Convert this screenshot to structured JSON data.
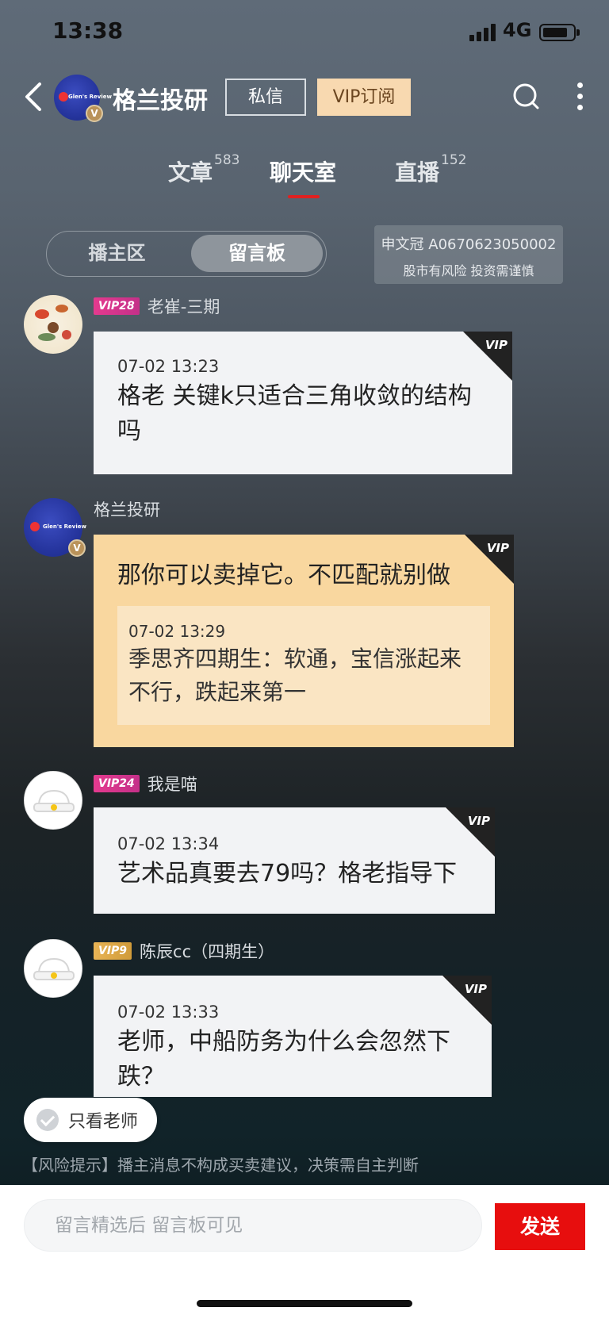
{
  "status_bar": {
    "time": "13:38",
    "network": "4G"
  },
  "header": {
    "title": "格兰投研",
    "avatar_text": "Glen's Review",
    "verified_badge": "V",
    "dm_label": "私信",
    "vip_label": "VIP订阅",
    "icons": [
      "back-icon",
      "search-icon",
      "more-icon"
    ]
  },
  "tabs": [
    {
      "label": "文章",
      "count": "583"
    },
    {
      "label": "聊天室",
      "count": ""
    },
    {
      "label": "直播",
      "count": "152"
    }
  ],
  "segmented": {
    "left": "播主区",
    "right": "留言板"
  },
  "license": {
    "line1": "申文冠 A0670623050002",
    "line2": "股市有风险 投资需谨慎"
  },
  "messages": [
    {
      "vip": "VIP28",
      "user": "老崔-三期",
      "time": "07-02 13:23",
      "text": "格老 关键k只适合三角收敛的结构吗"
    },
    {
      "user": "格兰投研",
      "text": "那你可以卖掉它。不匹配就别做",
      "quote": {
        "time": "07-02 13:29",
        "text": "季思齐四期生：软通，宝信涨起来不行，跌起来第一"
      }
    },
    {
      "vip": "VIP24",
      "user": "我是喵",
      "time": "07-02 13:34",
      "text": "艺术品真要去79吗？格老指导下"
    },
    {
      "vip": "VIP9",
      "user": "陈辰cc（四期生）",
      "time": "07-02 13:33",
      "text": "老师，中船防务为什么会忽然下跌？"
    }
  ],
  "vip_corner": "VIP",
  "only_teacher_label": "只看老师",
  "risk_notice": "【风险提示】播主消息不构成买卖建议，决策需自主判断",
  "input": {
    "placeholder": "留言精选后 留言板可见"
  },
  "send_label": "发送",
  "colors": {
    "accent_red": "#e70e0e",
    "vip_gold": "#f8d9b0",
    "teacher_bubble": "#f9d79f"
  }
}
